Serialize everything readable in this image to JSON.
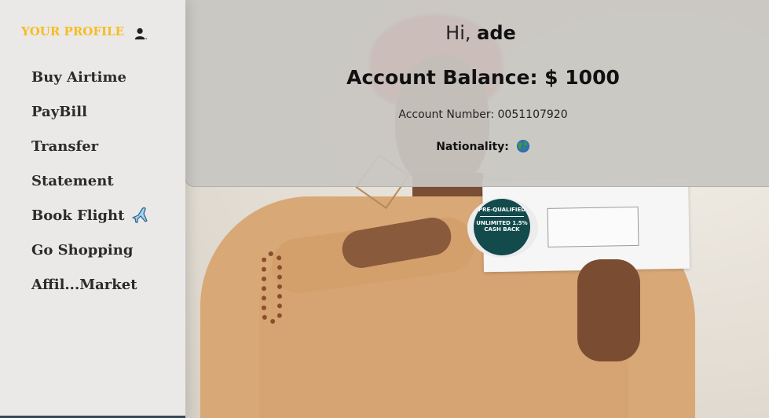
{
  "sidebar": {
    "profile_title": "YOUR PROFILE",
    "profile_icon": "user-icon",
    "items": [
      {
        "label": "Buy Airtime"
      },
      {
        "label": "PayBill"
      },
      {
        "label": "Transfer"
      },
      {
        "label": "Statement"
      },
      {
        "label": "Book Flight",
        "icon": "airplane-icon"
      },
      {
        "label": "Go Shopping"
      },
      {
        "label": "Affil...Market"
      }
    ]
  },
  "card": {
    "greeting_prefix": "Hi,",
    "username": "ade",
    "balance": "Account Balance: $ 1000",
    "account_number": "Account Number: 0051107920",
    "nationality_label": "Nationality:",
    "nationality_icon": "globe-icon"
  },
  "photo": {
    "badge_top": "PRE-QUALIFIED",
    "badge_main": "UNLIMITED 1.5% CASH BACK"
  },
  "colors": {
    "profile_title": "#f5bd1f",
    "sidebar_bg": "#ebe8e8",
    "card_bg": "#c8c6c2"
  }
}
